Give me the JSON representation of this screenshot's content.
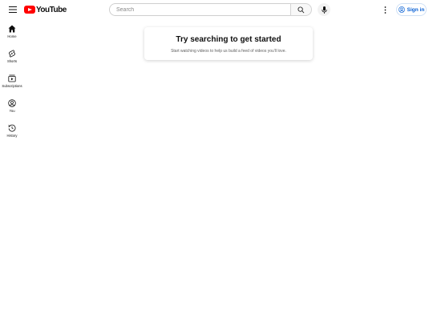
{
  "header": {
    "logo_text": "YouTube",
    "search_placeholder": "Search",
    "search_value": "",
    "signin_label": "Sign in"
  },
  "sidebar": {
    "items": [
      {
        "label": "Home",
        "icon": "home-icon"
      },
      {
        "label": "Shorts",
        "icon": "shorts-icon"
      },
      {
        "label": "Subscriptions",
        "icon": "subscriptions-icon"
      },
      {
        "label": "You",
        "icon": "you-icon"
      },
      {
        "label": "History",
        "icon": "history-icon"
      }
    ]
  },
  "main": {
    "title": "Try searching to get started",
    "subtitle": "Start watching videos to help us build a feed of videos you'll love."
  },
  "colors": {
    "brand_red": "#ff0000",
    "accent_blue": "#065fd4"
  }
}
